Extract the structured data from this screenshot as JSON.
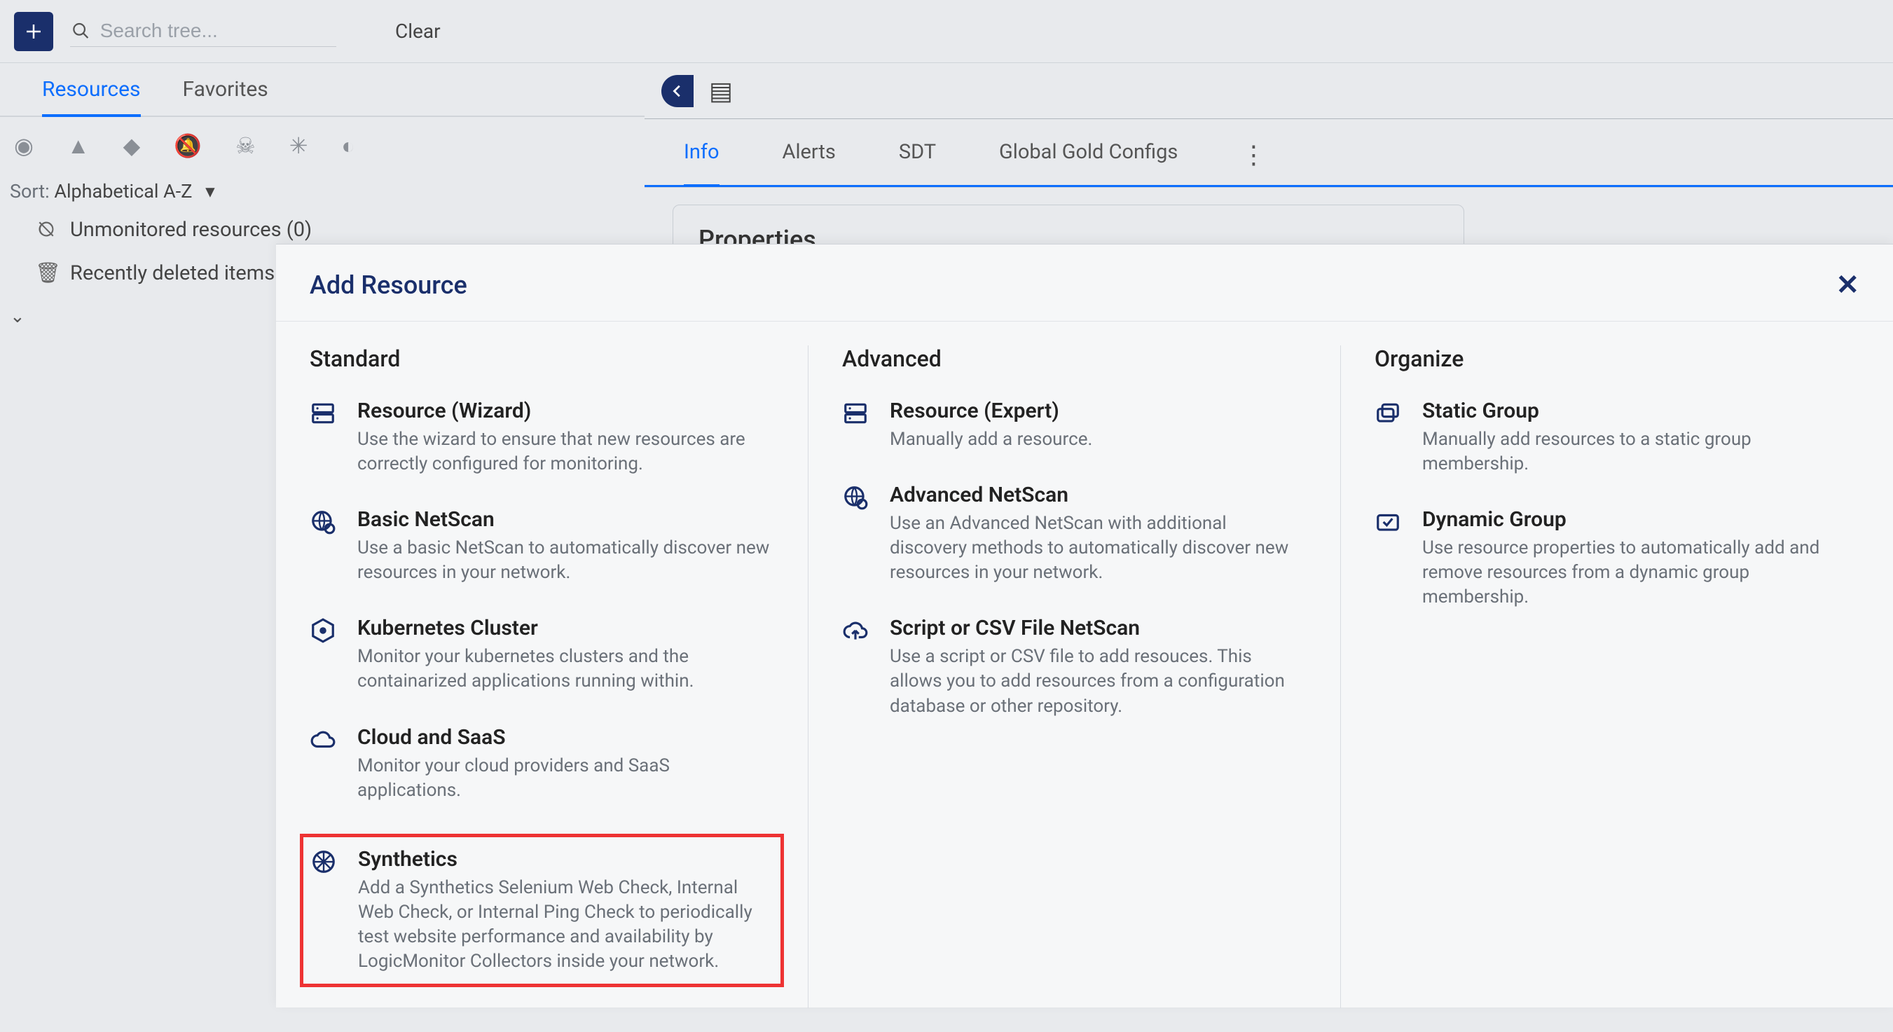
{
  "topbar": {
    "search_placeholder": "Search tree...",
    "clear_label": "Clear"
  },
  "left": {
    "tabs": {
      "resources": "Resources",
      "favorites": "Favorites"
    },
    "sort_prefix": "Sort:",
    "sort_value": "Alphabetical A-Z",
    "items": {
      "unmonitored": "Unmonitored resources (0)",
      "recent": "Recently deleted items ("
    }
  },
  "right": {
    "tabs": {
      "info": "Info",
      "alerts": "Alerts",
      "sdt": "SDT",
      "ggc": "Global Gold Configs"
    },
    "properties_heading": "Properties"
  },
  "modal": {
    "title": "Add Resource",
    "columns": {
      "standard": "Standard",
      "advanced": "Advanced",
      "organize": "Organize"
    },
    "standard": [
      {
        "title": "Resource (Wizard)",
        "desc": "Use the wizard to ensure that new resources are correctly configured for monitoring."
      },
      {
        "title": "Basic NetScan",
        "desc": "Use a basic NetScan to automatically discover new resources in your network."
      },
      {
        "title": "Kubernetes Cluster",
        "desc": "Monitor your kubernetes clusters and the containarized applications running within."
      },
      {
        "title": "Cloud and SaaS",
        "desc": "Monitor your cloud providers and SaaS applications."
      },
      {
        "title": "Synthetics",
        "desc": "Add a Synthetics Selenium Web Check, Internal Web Check, or Internal Ping Check to periodically test website performance and availability by LogicMonitor Collectors inside your network."
      }
    ],
    "advanced": [
      {
        "title": "Resource (Expert)",
        "desc": "Manually add a resource."
      },
      {
        "title": "Advanced NetScan",
        "desc": "Use an Advanced NetScan with additional discovery methods to automatically discover new resources in your network."
      },
      {
        "title": "Script or CSV File NetScan",
        "desc": "Use a script or CSV file to add resouces. This allows you to add resources from a configuration database or other repository."
      }
    ],
    "organize": [
      {
        "title": "Static Group",
        "desc": "Manually add resources to a static group membership."
      },
      {
        "title": "Dynamic Group",
        "desc": "Use resource properties to automatically add and remove resources from a dynamic group membership."
      }
    ]
  }
}
